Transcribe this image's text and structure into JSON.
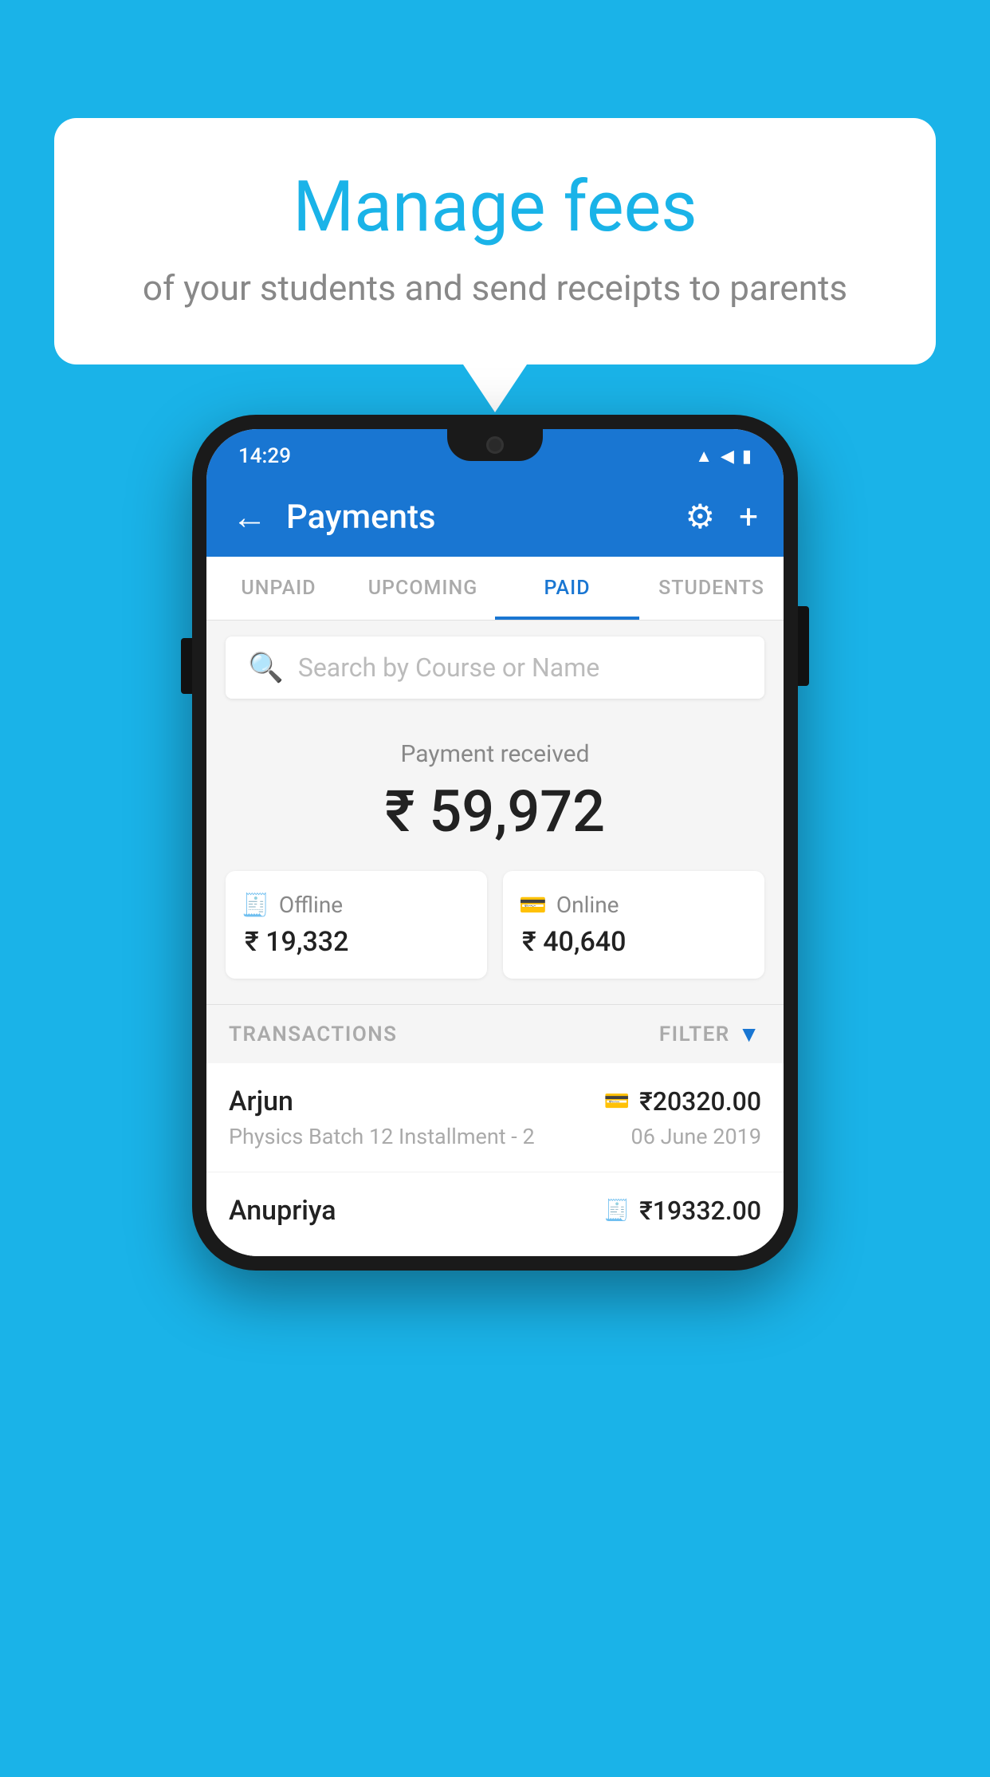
{
  "background_color": "#1ab3e8",
  "speech_bubble": {
    "title": "Manage fees",
    "subtitle": "of your students and send receipts to parents"
  },
  "status_bar": {
    "time": "14:29",
    "icons": [
      "wifi",
      "signal",
      "battery"
    ]
  },
  "app_bar": {
    "title": "Payments",
    "back_label": "←",
    "settings_icon": "⚙",
    "add_icon": "+"
  },
  "tabs": [
    {
      "label": "UNPAID",
      "active": false
    },
    {
      "label": "UPCOMING",
      "active": false
    },
    {
      "label": "PAID",
      "active": true
    },
    {
      "label": "STUDENTS",
      "active": false
    }
  ],
  "search": {
    "placeholder": "Search by Course or Name"
  },
  "payment_summary": {
    "received_label": "Payment received",
    "total_amount": "₹ 59,972",
    "offline": {
      "label": "Offline",
      "amount": "₹ 19,332"
    },
    "online": {
      "label": "Online",
      "amount": "₹ 40,640"
    }
  },
  "transactions": {
    "section_label": "TRANSACTIONS",
    "filter_label": "FILTER",
    "items": [
      {
        "name": "Arjun",
        "detail": "Physics Batch 12 Installment - 2",
        "amount": "₹20320.00",
        "date": "06 June 2019",
        "icon": "card"
      },
      {
        "name": "Anupriya",
        "detail": "",
        "amount": "₹19332.00",
        "date": "",
        "icon": "cash"
      }
    ]
  }
}
